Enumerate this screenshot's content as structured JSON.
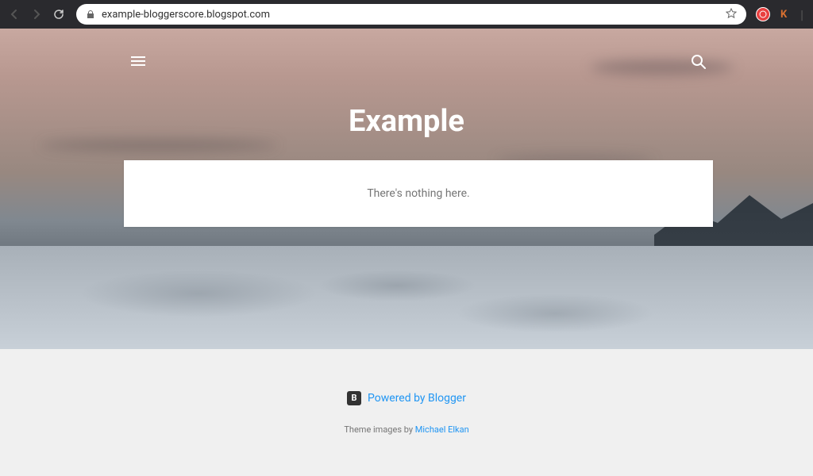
{
  "browser": {
    "url": "example-bloggerscore.blogspot.com"
  },
  "header": {
    "title": "Example"
  },
  "content": {
    "empty_message": "There's nothing here."
  },
  "footer": {
    "powered_label": "Powered by Blogger",
    "theme_prefix": "Theme images by ",
    "theme_author": "Michael Elkan",
    "blogger_icon_letter": "B"
  }
}
